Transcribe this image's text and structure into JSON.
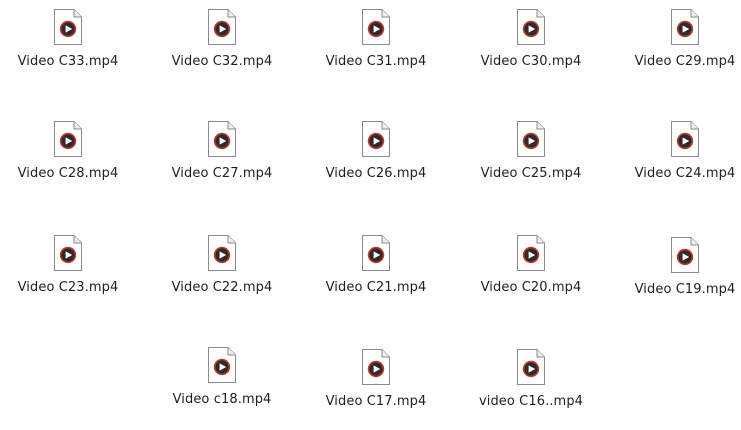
{
  "files": [
    {
      "name": "Video C33.mp4",
      "icon": "video-file-icon"
    },
    {
      "name": "Video C32.mp4",
      "icon": "video-file-icon"
    },
    {
      "name": "Video C31.mp4",
      "icon": "video-file-icon"
    },
    {
      "name": "Video C30.mp4",
      "icon": "video-file-icon"
    },
    {
      "name": "Video C29.mp4",
      "icon": "video-file-icon"
    },
    {
      "name": "Video C28.mp4",
      "icon": "video-file-icon"
    },
    {
      "name": "Video C27.mp4",
      "icon": "video-file-icon"
    },
    {
      "name": "Video C26.mp4",
      "icon": "video-file-icon"
    },
    {
      "name": "Video C25.mp4",
      "icon": "video-file-icon"
    },
    {
      "name": "Video C24.mp4",
      "icon": "video-file-icon"
    },
    {
      "name": "Video C23.mp4",
      "icon": "video-file-icon"
    },
    {
      "name": "Video C22.mp4",
      "icon": "video-file-icon"
    },
    {
      "name": "Video C21.mp4",
      "icon": "video-file-icon"
    },
    {
      "name": "Video C20.mp4",
      "icon": "video-file-icon"
    },
    {
      "name": "Video C19.mp4",
      "icon": "video-file-icon"
    },
    {
      "name": "Video c18.mp4",
      "icon": "video-file-icon"
    },
    {
      "name": "Video C17.mp4",
      "icon": "video-file-icon"
    },
    {
      "name": "video C16..mp4",
      "icon": "video-file-icon"
    }
  ],
  "colors": {
    "page_bg": "#ffffff",
    "text": "#1f1f1f",
    "icon_disc_ring": "#c0392b",
    "icon_disc": "#2b2b2b",
    "icon_play": "#ffffff"
  }
}
